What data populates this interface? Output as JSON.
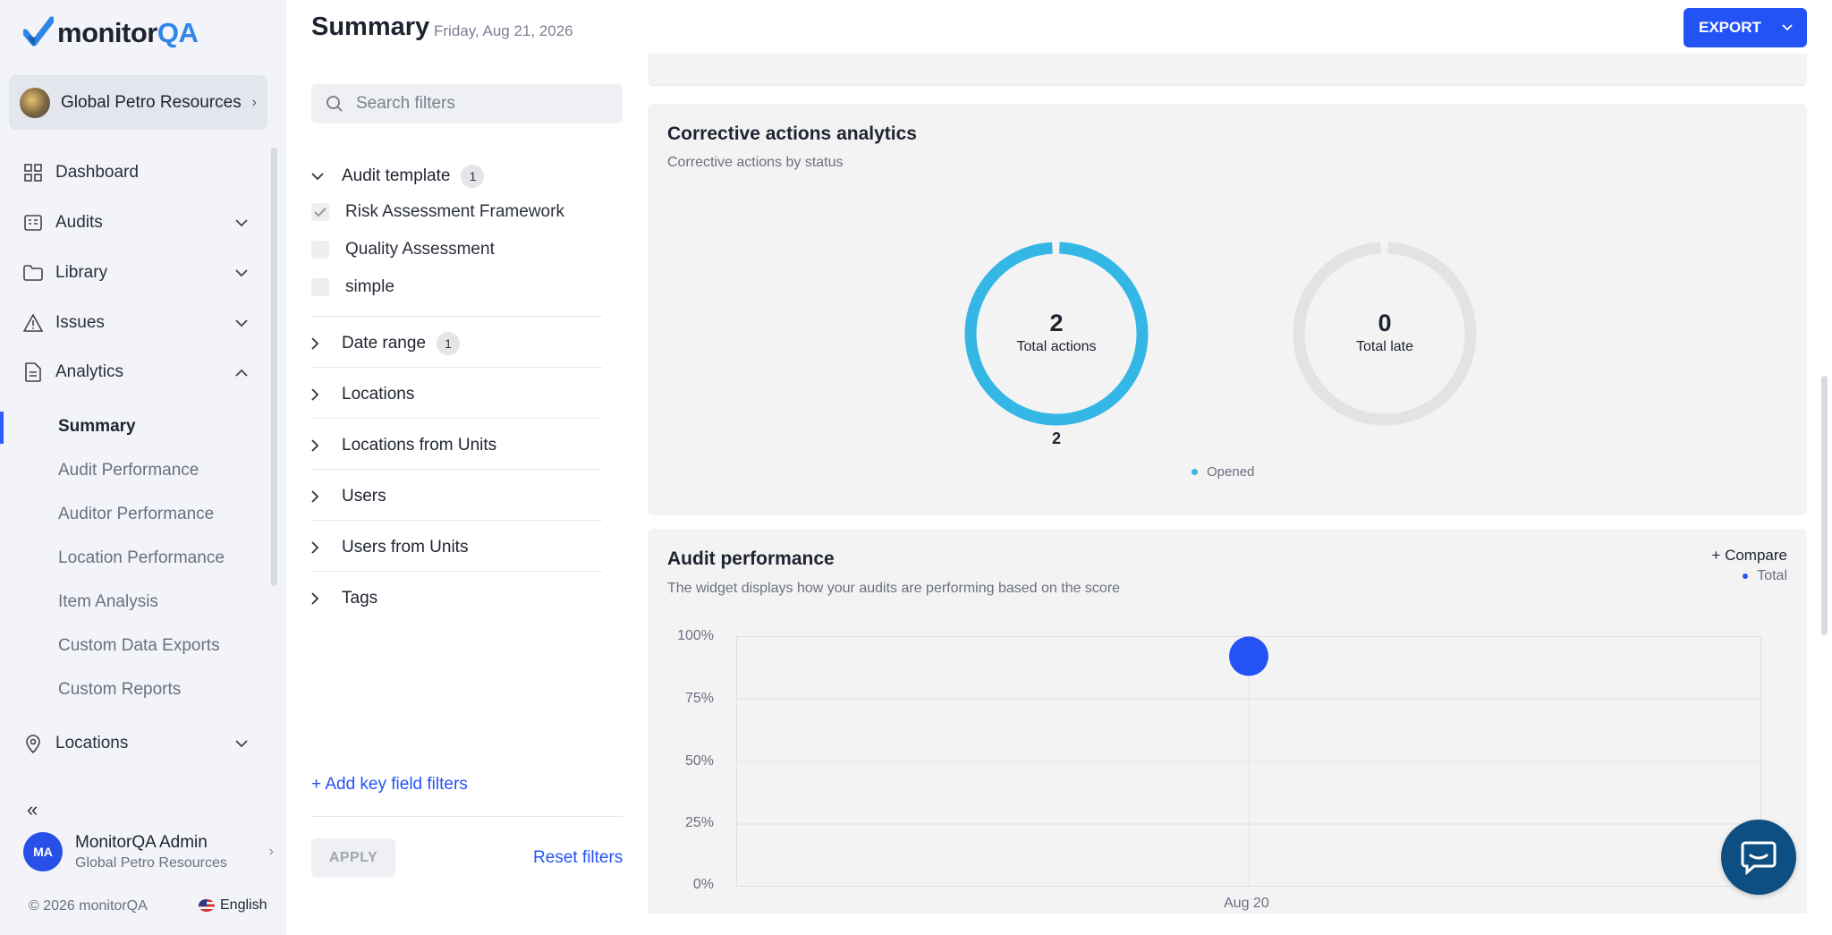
{
  "app": {
    "name_prefix": "monitor",
    "name_suffix": "QA"
  },
  "org": {
    "name": "Global Petro Resources"
  },
  "nav": {
    "dashboard": "Dashboard",
    "audits": "Audits",
    "library": "Library",
    "issues": "Issues",
    "analytics": "Analytics",
    "locations": "Locations",
    "analytics_sub": [
      "Summary",
      "Audit Performance",
      "Auditor Performance",
      "Location Performance",
      "Item Analysis",
      "Custom Data Exports",
      "Custom Reports"
    ],
    "collapse_glyph": "«"
  },
  "user": {
    "initials": "MA",
    "name": "MonitorQA Admin",
    "org": "Global Petro Resources"
  },
  "footer": {
    "copyright": "© 2026 monitorQA",
    "language": "English"
  },
  "header": {
    "title": "Summary",
    "date": "Friday, Aug 21, 2026",
    "export_label": "EXPORT"
  },
  "filters": {
    "search_placeholder": "Search filters",
    "audit_template": {
      "label": "Audit template",
      "count": "1",
      "options": [
        {
          "label": "Risk Assessment Framework",
          "checked": true
        },
        {
          "label": "Quality Assessment",
          "checked": false
        },
        {
          "label": "simple",
          "checked": false
        }
      ]
    },
    "date_range": {
      "label": "Date range",
      "count": "1"
    },
    "groups": [
      "Locations",
      "Locations from Units",
      "Users",
      "Users from Units",
      "Tags"
    ],
    "add_key": "+ Add key field filters",
    "apply": "APPLY",
    "reset": "Reset filters"
  },
  "corrective": {
    "title": "Corrective actions analytics",
    "subtitle": "Corrective actions by status",
    "total_actions": {
      "value": "2",
      "label": "Total actions",
      "below": "2"
    },
    "total_late": {
      "value": "0",
      "label": "Total late"
    },
    "legend": "Opened",
    "colors": {
      "opened": "#35b7e6",
      "empty": "#e3e3e5"
    }
  },
  "performance": {
    "title": "Audit performance",
    "subtitle": "The widget displays how your audits are performing based on the score",
    "compare": "+ Compare",
    "legend": "Total"
  },
  "chart_data": {
    "type": "scatter",
    "series": [
      {
        "name": "Total",
        "color": "#2453f5",
        "x": [
          "Aug 20"
        ],
        "y": [
          92
        ]
      }
    ],
    "yticks": [
      "100%",
      "75%",
      "50%",
      "25%",
      "0%"
    ],
    "xticks": [
      "Aug 20"
    ],
    "ylim": [
      0,
      100
    ],
    "grid": true,
    "legend": "top-right"
  }
}
